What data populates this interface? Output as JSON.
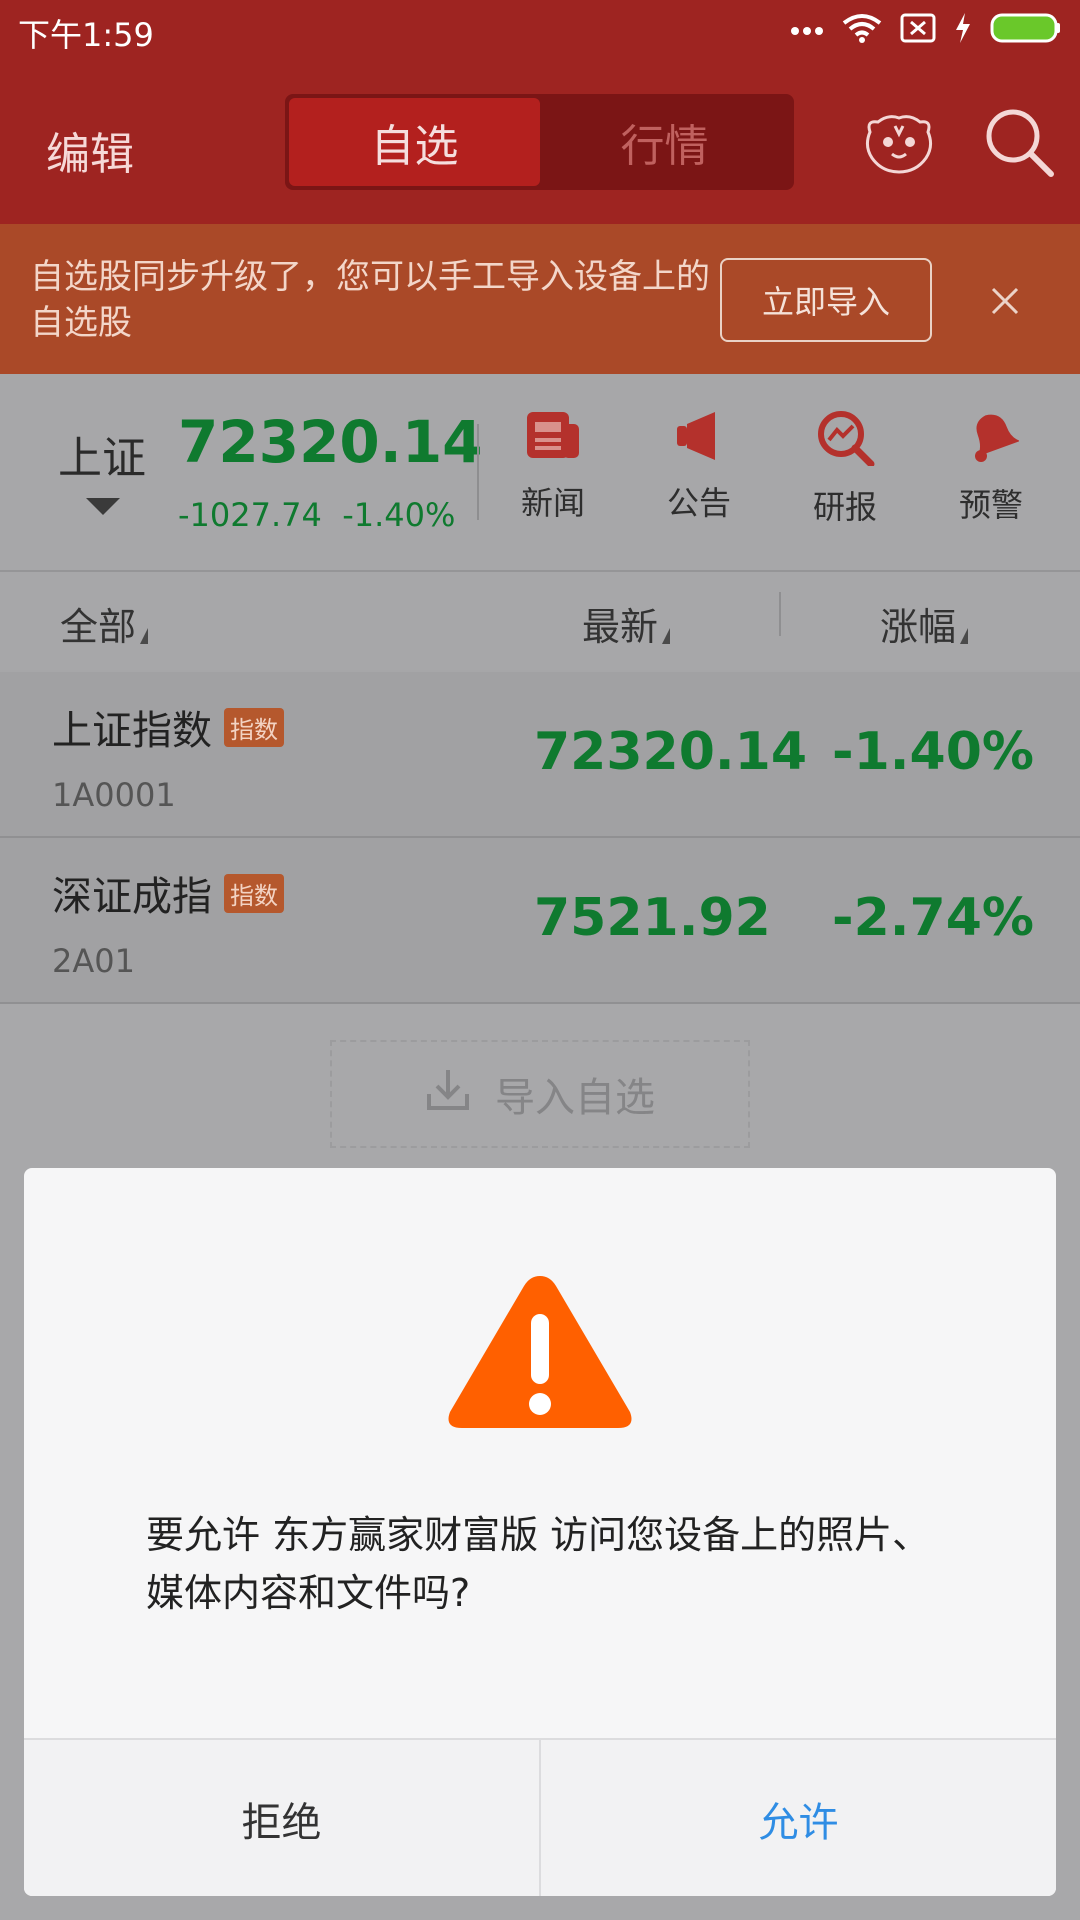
{
  "status_bar": {
    "time": "下午1:59"
  },
  "header": {
    "edit_label": "编辑",
    "tabs": [
      {
        "label": "自选",
        "active": true
      },
      {
        "label": "行情",
        "active": false
      }
    ],
    "icons": [
      "tiger-mascot-icon",
      "search-icon"
    ]
  },
  "banner": {
    "message": "自选股同步升级了，您可以手工导入设备上的自选股",
    "import_button": "立即导入"
  },
  "index_panel": {
    "market": "上证",
    "value": "72320.14",
    "change": "-1027.74",
    "change_pct": "-1.40%",
    "actions": [
      {
        "label": "新闻",
        "icon": "news-icon"
      },
      {
        "label": "公告",
        "icon": "megaphone-icon"
      },
      {
        "label": "研报",
        "icon": "research-report-icon"
      },
      {
        "label": "预警",
        "icon": "alert-bell-icon"
      }
    ]
  },
  "table": {
    "headers": {
      "all": "全部",
      "latest": "最新",
      "change": "涨幅"
    },
    "rows": [
      {
        "name": "上证指数",
        "tag": "指数",
        "code": "1A0001",
        "price": "72320.14",
        "pct": "-1.40%"
      },
      {
        "name": "深证成指",
        "tag": "指数",
        "code": "2A01",
        "price": "7521.92",
        "pct": "-2.74%"
      }
    ]
  },
  "import_area": {
    "label": "导入自选"
  },
  "dialog": {
    "message": "要允许 东方赢家财富版 访问您设备上的照片、媒体内容和文件吗?",
    "deny": "拒绝",
    "allow": "允许"
  },
  "colors": {
    "header_red": "#9e2421",
    "banner_orange": "#aa4928",
    "stock_green": "#0f7a2f",
    "warning_orange": "#ff6000",
    "allow_blue": "#2f8de4"
  }
}
